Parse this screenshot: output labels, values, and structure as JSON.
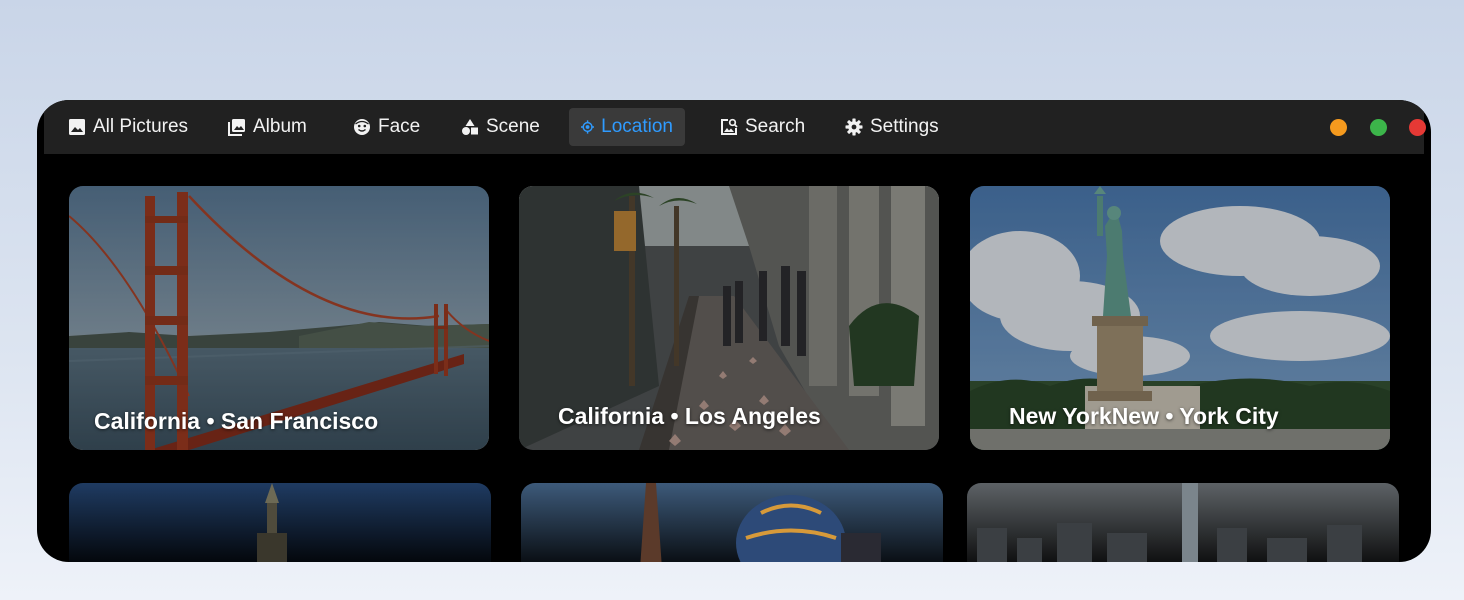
{
  "nav": {
    "items": [
      {
        "label": "All Pictures",
        "icon": "image-icon"
      },
      {
        "label": "Album",
        "icon": "album-icon"
      },
      {
        "label": "Face",
        "icon": "face-icon"
      },
      {
        "label": "Scene",
        "icon": "shapes-icon"
      },
      {
        "label": "Location",
        "icon": "location-target-icon",
        "active": true
      },
      {
        "label": "Search",
        "icon": "image-search-icon"
      },
      {
        "label": "Settings",
        "icon": "gear-icon"
      }
    ]
  },
  "window_controls": {
    "minimize_color": "#f59a1e",
    "maximize_color": "#3cb54a",
    "close_color": "#e53935"
  },
  "accent_color": "#2f9bff",
  "locations": [
    {
      "caption": "California • San Francisco",
      "scene": "golden gate bridge"
    },
    {
      "caption": "California • Los Angeles",
      "scene": "hollywood walk of fame"
    },
    {
      "caption": "New YorkNew • York City",
      "scene": "statue of liberty"
    },
    {
      "caption": "",
      "scene": "castle spire"
    },
    {
      "caption": "",
      "scene": "eiffel tower and hot air balloon"
    },
    {
      "caption": "",
      "scene": "city skyline"
    }
  ]
}
